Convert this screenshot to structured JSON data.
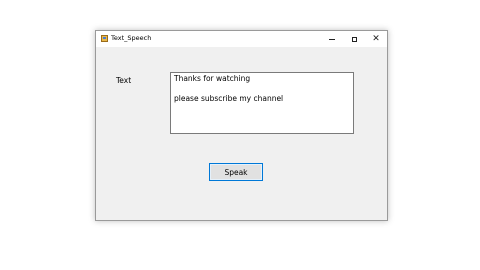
{
  "window": {
    "title": "Text_Speech"
  },
  "form": {
    "text_label": "Text",
    "text_value": "Thanks for watching\n\nplease subscribe my channel",
    "speak_label": "Speak"
  },
  "icons": {
    "app": "app-icon",
    "minimize": "minimize-icon",
    "maximize": "maximize-icon",
    "close": "close-icon",
    "close_glyph": "✕"
  },
  "colors": {
    "window_bg": "#f0f0f0",
    "titlebar_bg": "#ffffff",
    "button_focus_border": "#0078d7"
  }
}
